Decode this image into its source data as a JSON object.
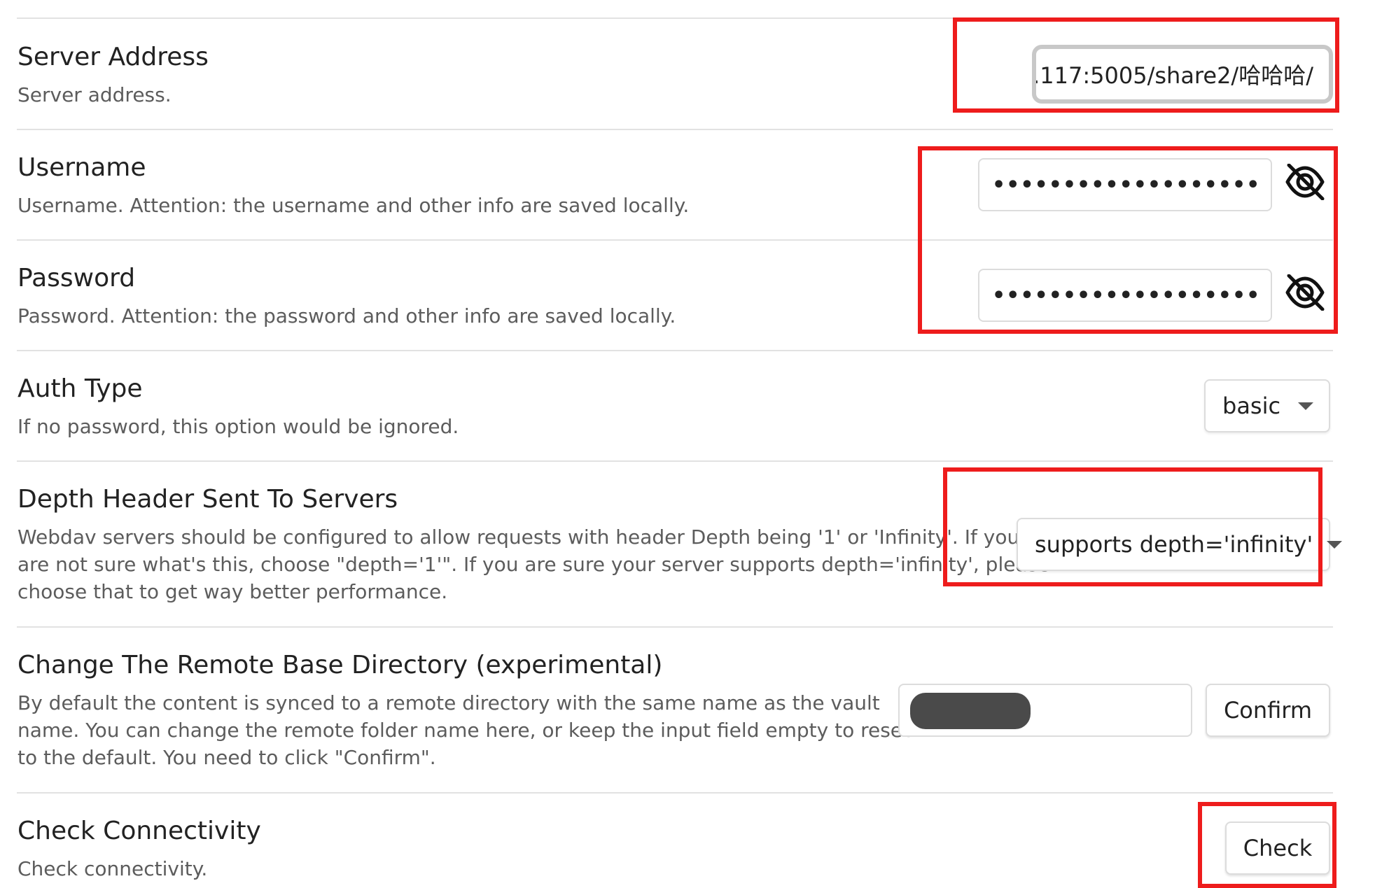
{
  "settings": {
    "server_address": {
      "name": "Server Address",
      "desc": "Server address.",
      "value": ".117:5005/share2/哈哈哈/"
    },
    "username": {
      "name": "Username",
      "desc": "Username. Attention: the username and other info are saved locally.",
      "masked_value": "••••••••••••••••••••••••••••"
    },
    "password": {
      "name": "Password",
      "desc": "Password. Attention: the password and other info are saved locally.",
      "masked_value": "••••••••••••••••••••••••••••"
    },
    "auth_type": {
      "name": "Auth Type",
      "desc": "If no password, this option would be ignored.",
      "selected": "basic"
    },
    "depth_header": {
      "name": "Depth Header Sent To Servers",
      "desc_line1": "Webdav servers should be configured to allow requests with header Depth being '1' or 'Infinity'. If you",
      "desc_line2": "are not sure what's this, choose \"depth='1'\". If you are sure your server supports depth='infinity', please",
      "desc_line3": "choose that to get way better performance.",
      "selected": "supports depth='infinity'"
    },
    "remote_base_dir": {
      "name": "Change The Remote Base Directory (experimental)",
      "desc_line1": "By default the content is synced to a remote directory with the same name as the vault",
      "desc_line2": "name. You can change the remote folder name here, or keep the input field empty to reset",
      "desc_line3": "to the default. You need to click \"Confirm\".",
      "confirm_label": "Confirm"
    },
    "check_connectivity": {
      "name": "Check Connectivity",
      "desc": "Check connectivity.",
      "check_label": "Check"
    }
  },
  "colors": {
    "highlight": "#ee1c1c",
    "redaction": "#4a4a4a"
  },
  "icons": {
    "visibility_toggle": "eye-off-icon",
    "dropdown": "chevron-down-icon"
  }
}
